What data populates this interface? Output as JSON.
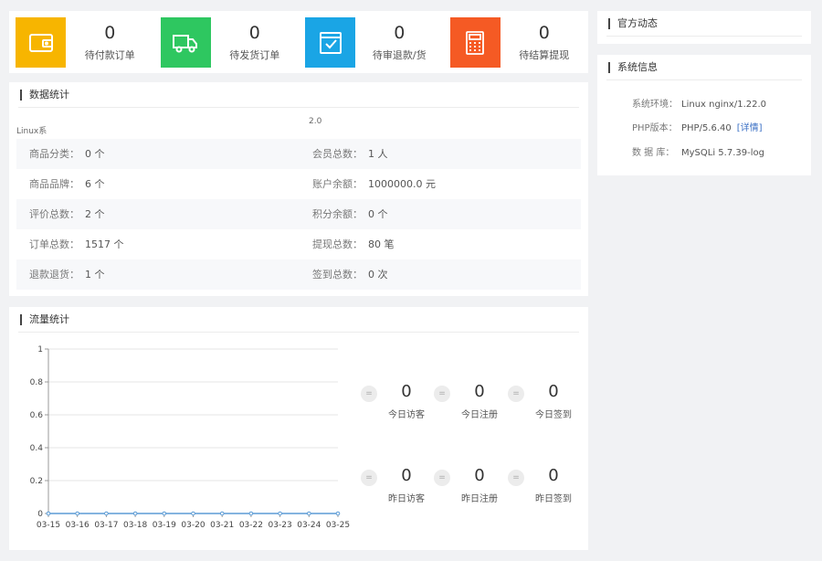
{
  "cards": [
    {
      "value": "0",
      "label": "待付款订单",
      "color": "#f7b500",
      "icon": "wallet-icon"
    },
    {
      "value": "0",
      "label": "待发货订单",
      "color": "#2ec760",
      "icon": "truck-icon"
    },
    {
      "value": "0",
      "label": "待审退款/货",
      "color": "#1aa5e5",
      "icon": "check-box-icon"
    },
    {
      "value": "0",
      "label": "待结算提现",
      "color": "#f55a24",
      "icon": "calculator-icon"
    }
  ],
  "stats": {
    "title": "数据统计",
    "faint_left": "Linux系",
    "faint_right": "2.0",
    "rows": [
      {
        "lk": "商品分类：",
        "lv": "0 个",
        "rk": "会员总数：",
        "rv": "1 人"
      },
      {
        "lk": "商品品牌：",
        "lv": "6 个",
        "rk": "账户余额：",
        "rv": "1000000.0 元"
      },
      {
        "lk": "评价总数：",
        "lv": "2 个",
        "rk": "积分余额：",
        "rv": "0 个"
      },
      {
        "lk": "订单总数：",
        "lv": "1517 个",
        "rk": "提现总数：",
        "rv": "80 笔"
      },
      {
        "lk": "退款退货：",
        "lv": "1 个",
        "rk": "签到总数：",
        "rv": "0 次"
      }
    ]
  },
  "traffic": {
    "title": "流量统计",
    "circle_glyph": "=",
    "today": [
      {
        "value": "0",
        "label": "今日访客"
      },
      {
        "value": "0",
        "label": "今日注册"
      },
      {
        "value": "0",
        "label": "今日签到"
      }
    ],
    "yesterday": [
      {
        "value": "0",
        "label": "昨日访客"
      },
      {
        "value": "0",
        "label": "昨日注册"
      },
      {
        "value": "0",
        "label": "昨日签到"
      }
    ]
  },
  "chart_data": {
    "type": "line",
    "x": [
      "03-15",
      "03-16",
      "03-17",
      "03-18",
      "03-19",
      "03-20",
      "03-21",
      "03-22",
      "03-23",
      "03-24",
      "03-25"
    ],
    "series": [
      {
        "values": [
          0,
          0,
          0,
          0,
          0,
          0,
          0,
          0,
          0,
          0,
          0
        ]
      }
    ],
    "y_ticks": [
      "0",
      "0.2",
      "0.4",
      "0.6",
      "0.8",
      "1"
    ],
    "ylim": [
      0,
      1
    ],
    "grid": true,
    "line_color": "#5b9bd5"
  },
  "news": {
    "title": "官方动态"
  },
  "sysinfo": {
    "title": "系统信息",
    "rows": [
      {
        "k": "系统环境：",
        "v": "Linux nginx/1.22.0"
      },
      {
        "k": "PHP版本：",
        "v": "PHP/5.6.40",
        "link": "[详情]"
      },
      {
        "k": "数 据 库：",
        "v": "MySQLi 5.7.39-log"
      }
    ]
  }
}
